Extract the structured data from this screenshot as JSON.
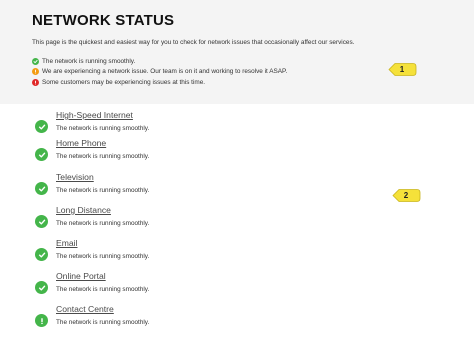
{
  "page": {
    "title": "NETWORK STATUS",
    "intro": "This page is the quickest and easiest way for you to check for network issues that occasionally affect our services."
  },
  "legend": [
    {
      "status": "ok",
      "color": "#44b54a",
      "text": "The network is running smoothly."
    },
    {
      "status": "issue",
      "color": "#f39c12",
      "text": "We are experiencing a network issue. Our team is on it and working to resolve it ASAP."
    },
    {
      "status": "outage",
      "color": "#e02828",
      "text": "Some customers may be experiencing issues at this time."
    }
  ],
  "callouts": [
    "1",
    "2"
  ],
  "services": [
    {
      "name": "High-Speed Internet",
      "status": "The network is running smoothly.",
      "state": "ok"
    },
    {
      "name": "Home Phone",
      "status": "The network is running smoothly.",
      "state": "ok"
    },
    {
      "name": "Television",
      "status": "The network is running smoothly.",
      "state": "ok"
    },
    {
      "name": "Long Distance",
      "status": "The network is running smoothly.",
      "state": "ok"
    },
    {
      "name": "Email",
      "status": "The network is running smoothly.",
      "state": "ok"
    },
    {
      "name": "Online Portal",
      "status": "The network is running smoothly.",
      "state": "ok"
    },
    {
      "name": "Contact Centre",
      "status": "The network is running smoothly.",
      "state": "info"
    }
  ],
  "colors": {
    "ok": "#44b54a",
    "callout": "#f5e13a"
  }
}
